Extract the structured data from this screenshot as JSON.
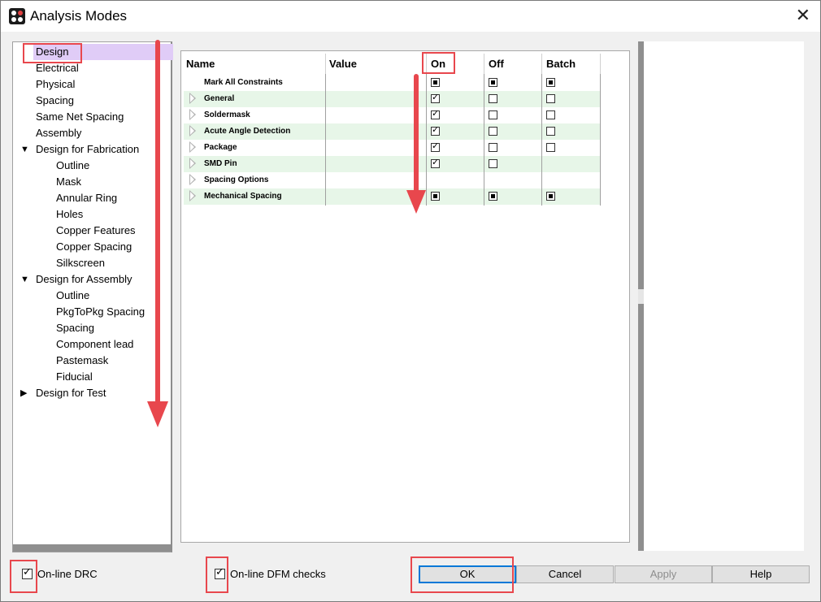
{
  "window": {
    "title": "Analysis Modes",
    "close_glyph": "✕"
  },
  "tree": {
    "items": [
      {
        "label": "Design",
        "level": 0,
        "selected": true
      },
      {
        "label": "Electrical",
        "level": 0
      },
      {
        "label": "Physical",
        "level": 0
      },
      {
        "label": "Spacing",
        "level": 0
      },
      {
        "label": "Same Net Spacing",
        "level": 0
      },
      {
        "label": "Assembly",
        "level": 0
      },
      {
        "label": "Design for Fabrication",
        "level": 0,
        "toggle": "▼"
      },
      {
        "label": "Outline",
        "level": 1
      },
      {
        "label": "Mask",
        "level": 1
      },
      {
        "label": "Annular Ring",
        "level": 1
      },
      {
        "label": "Holes",
        "level": 1
      },
      {
        "label": "Copper Features",
        "level": 1
      },
      {
        "label": "Copper Spacing",
        "level": 1
      },
      {
        "label": "Silkscreen",
        "level": 1
      },
      {
        "label": "Design for Assembly",
        "level": 0,
        "toggle": "▼"
      },
      {
        "label": "Outline",
        "level": 1
      },
      {
        "label": "PkgToPkg Spacing",
        "level": 1
      },
      {
        "label": "Spacing",
        "level": 1
      },
      {
        "label": "Component lead",
        "level": 1
      },
      {
        "label": "Pastemask",
        "level": 1
      },
      {
        "label": "Fiducial",
        "level": 1
      },
      {
        "label": "Design for Test",
        "level": 0,
        "toggle": "▶"
      }
    ]
  },
  "table": {
    "headers": {
      "name": "Name",
      "value": "Value",
      "on": "On",
      "off": "Off",
      "batch": "Batch"
    },
    "rows": [
      {
        "name": "Mark All Constraints",
        "expandable": false,
        "on": "filled",
        "off": "filled",
        "batch": "filled"
      },
      {
        "name": "General",
        "expandable": true,
        "on": "checked",
        "off": "empty",
        "batch": "empty"
      },
      {
        "name": "Soldermask",
        "expandable": true,
        "on": "checked",
        "off": "empty",
        "batch": "empty"
      },
      {
        "name": "Acute Angle Detection",
        "expandable": true,
        "on": "checked",
        "off": "empty",
        "batch": "empty"
      },
      {
        "name": "Package",
        "expandable": true,
        "on": "checked",
        "off": "empty",
        "batch": "empty"
      },
      {
        "name": "SMD Pin",
        "expandable": true,
        "on": "checked",
        "off": "empty",
        "batch": "none"
      },
      {
        "name": "Spacing Options",
        "expandable": true,
        "on": "none",
        "off": "none",
        "batch": "none"
      },
      {
        "name": "Mechanical Spacing",
        "expandable": true,
        "on": "filled",
        "off": "filled",
        "batch": "filled"
      }
    ]
  },
  "bottom": {
    "online_drc": {
      "label": "On-line DRC",
      "checked": true
    },
    "online_dfm": {
      "label": "On-line DFM checks",
      "checked": true
    },
    "buttons": {
      "ok": "OK",
      "cancel": "Cancel",
      "apply": "Apply",
      "help": "Help"
    }
  },
  "annotation_color": "#e8474d"
}
